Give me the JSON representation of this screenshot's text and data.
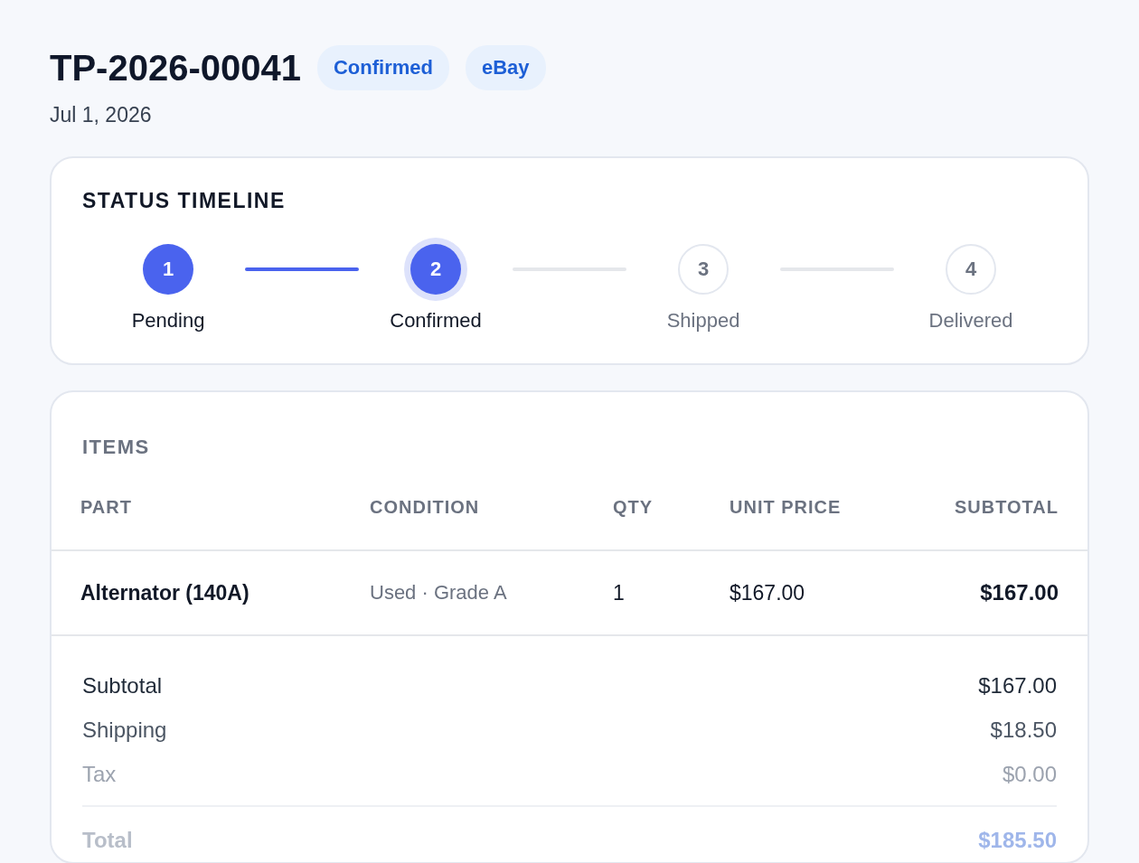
{
  "order": {
    "number": "TP-2026-00041",
    "date": "Jul 1, 2026",
    "badges": [
      "Confirmed",
      "eBay"
    ]
  },
  "timeline": {
    "title": "STATUS TIMELINE",
    "steps": [
      {
        "number": "1",
        "label": "Pending",
        "done": true,
        "selected": false
      },
      {
        "number": "2",
        "label": "Confirmed",
        "done": true,
        "selected": true
      },
      {
        "number": "3",
        "label": "Shipped",
        "done": false,
        "selected": false
      },
      {
        "number": "4",
        "label": "Delivered",
        "done": false,
        "selected": false
      }
    ],
    "connectors": [
      {
        "done": true
      },
      {
        "done": false
      },
      {
        "done": false
      }
    ]
  },
  "items": {
    "title": "ITEMS",
    "columns": [
      "PART",
      "CONDITION",
      "QTY",
      "UNIT PRICE",
      "SUBTOTAL"
    ],
    "rows": [
      {
        "part": "Alternator (140A)",
        "condition": "Used · Grade A",
        "qty": "1",
        "unit_price": "$167.00",
        "subtotal": "$167.00"
      }
    ]
  },
  "summary": [
    {
      "label": "Subtotal",
      "value": "$167.00",
      "kind": "strong"
    },
    {
      "label": "Shipping",
      "value": "$18.50",
      "kind": "normal"
    },
    {
      "label": "Tax",
      "value": "$0.00",
      "kind": "muted"
    },
    {
      "label": "Total",
      "value": "$185.50",
      "kind": "total"
    }
  ]
}
